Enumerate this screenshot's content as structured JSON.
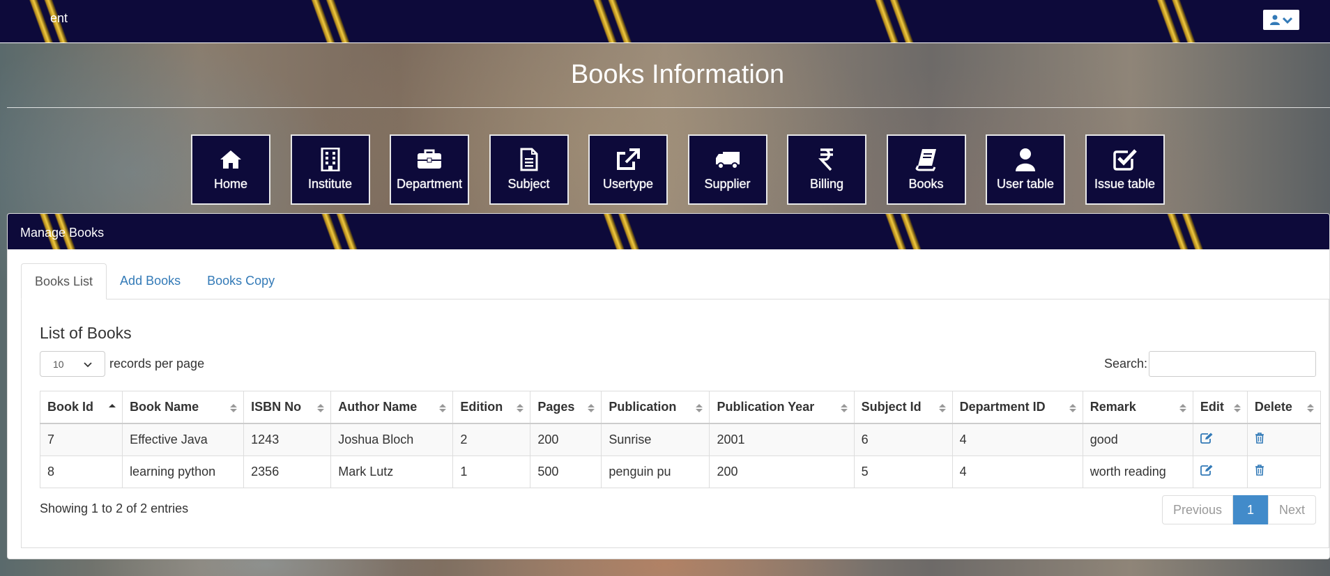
{
  "topbar": {
    "brand": "ent"
  },
  "page": {
    "title": "Books Information"
  },
  "nav": [
    {
      "label": "Home",
      "icon": "home-icon"
    },
    {
      "label": "Institute",
      "icon": "building-icon"
    },
    {
      "label": "Department",
      "icon": "briefcase-icon"
    },
    {
      "label": "Subject",
      "icon": "file-text-icon"
    },
    {
      "label": "Usertype",
      "icon": "external-link-icon"
    },
    {
      "label": "Supplier",
      "icon": "truck-icon"
    },
    {
      "label": "Billing",
      "icon": "rupee-icon"
    },
    {
      "label": "Books",
      "icon": "book-icon"
    },
    {
      "label": "User table",
      "icon": "user-icon"
    },
    {
      "label": "Issue table",
      "icon": "check-square-icon"
    }
  ],
  "panel": {
    "heading": "Manage Books"
  },
  "tabs": [
    {
      "label": "Books List",
      "active": true
    },
    {
      "label": "Add Books",
      "active": false
    },
    {
      "label": "Books Copy",
      "active": false
    }
  ],
  "list": {
    "title": "List of Books",
    "length_value": "10",
    "length_suffix": "records per page",
    "search_label": "Search:",
    "search_value": ""
  },
  "table": {
    "columns": [
      "Book Id",
      "Book Name",
      "ISBN No",
      "Author Name",
      "Edition",
      "Pages",
      "Publication",
      "Publication Year",
      "Subject Id",
      "Department ID",
      "Remark",
      "Edit",
      "Delete"
    ],
    "rows": [
      [
        "7",
        "Effective Java",
        "1243",
        "Joshua Bloch",
        "2",
        "200",
        "Sunrise",
        "2001",
        "6",
        "4",
        "good"
      ],
      [
        "8",
        "learning python",
        "2356",
        "Mark Lutz",
        "1",
        "500",
        "penguin pu",
        "200",
        "5",
        "4",
        "worth reading"
      ]
    ]
  },
  "footer": {
    "info": "Showing 1 to 2 of 2 entries",
    "previous": "Previous",
    "current_page": "1",
    "next": "Next"
  },
  "colors": {
    "navy": "#0d0a3a",
    "gold": "#f0c940",
    "link": "#337ab7",
    "active_page": "#428bca"
  }
}
